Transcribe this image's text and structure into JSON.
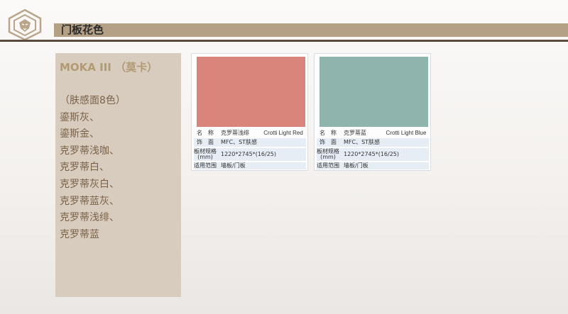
{
  "header": {
    "title": "门板花色"
  },
  "side_panel": {
    "heading": "MOKA III （莫卡）",
    "lines": [
      "（肤感面8色）",
      "鎏斯灰、",
      "鎏斯金、",
      "克罗蒂浅咖、",
      "克罗蒂白、",
      "克罗蒂灰白、",
      "克罗蒂蓝灰、",
      "克罗蒂浅绯、",
      "克罗蒂蓝"
    ]
  },
  "cards": [
    {
      "swatch_color": "#d9857c",
      "name_label": "名　称",
      "name_cn": "克罗蒂浅绯",
      "name_en": "Crotti Light Red",
      "finish_label": "饰　面",
      "finish_value": "MFC、ST肤感",
      "spec_label_1": "板材规格",
      "spec_label_2": "(mm)",
      "spec_value": "1220*2745*(16/25)",
      "scope_label": "适用范围",
      "scope_value": "墙板/门板"
    },
    {
      "swatch_color": "#8fb3ad",
      "name_label": "名　称",
      "name_cn": "克罗蒂蓝",
      "name_en": "Crotti Light Blue",
      "finish_label": "饰　面",
      "finish_value": "MFC、ST肤感",
      "spec_label_1": "板材规格",
      "spec_label_2": "(mm)",
      "spec_value": "1220*2745*(16/25)",
      "scope_label": "适用范围",
      "scope_value": "墙板/门板"
    }
  ]
}
